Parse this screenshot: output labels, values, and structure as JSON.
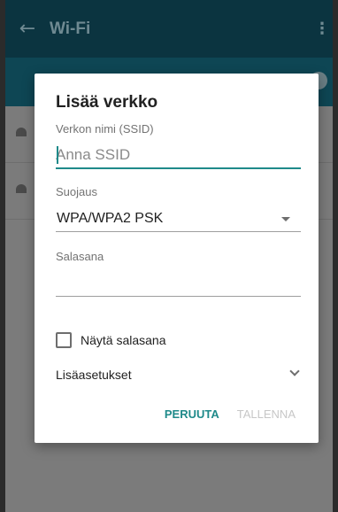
{
  "app": {
    "title": "Wi-Fi",
    "back_glyph": "←",
    "menu_glyph": "⋮"
  },
  "dialog": {
    "title": "Lisää verkko",
    "ssid_label": "Verkon nimi (SSID)",
    "ssid_placeholder": "Anna SSID",
    "security_label": "Suojaus",
    "security_value": "WPA/WPA2 PSK",
    "password_label": "Salasana",
    "password_value": "",
    "show_password_label": "Näytä salasana",
    "show_password_checked": false,
    "advanced_label": "Lisäasetukset",
    "cancel_label": "PERUUTA",
    "save_label": "TALLENNA"
  },
  "colors": {
    "accent": "#1f8a8a",
    "disabled": "#c7c7c7",
    "appbar": "#0b3440"
  },
  "icons": {
    "back": "arrow-back-icon",
    "menu": "more-vert-icon",
    "dropdown": "caret-down-icon",
    "expand": "chevron-down-icon"
  }
}
